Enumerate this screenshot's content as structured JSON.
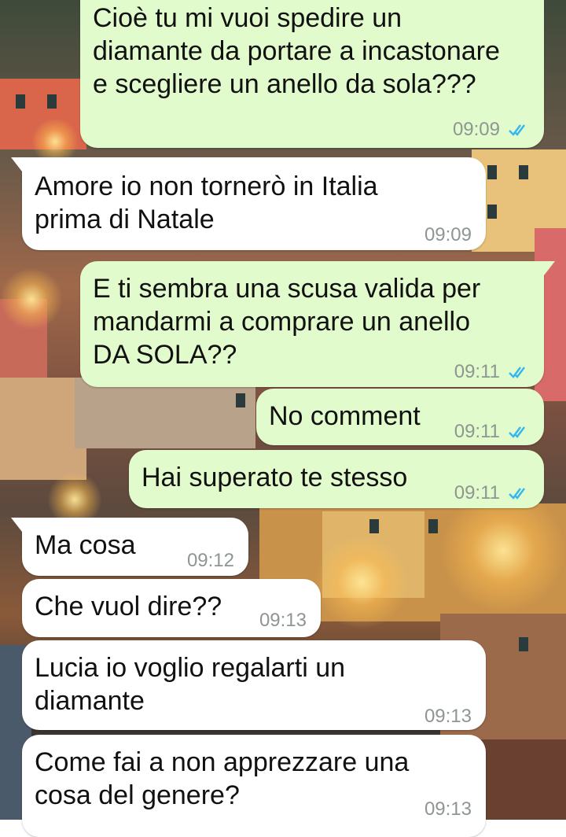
{
  "colors": {
    "outgoing_bubble": "#e2fbcc",
    "incoming_bubble": "#ffffff",
    "read_ticks": "#34b7f1",
    "timestamp": "#8e9691"
  },
  "messages": [
    {
      "direction": "outgoing",
      "text": "Cioè tu mi vuoi spedire un\ndiamante da portare a incastonare\ne scegliere un anello da sola???",
      "time": "09:09",
      "status": "read-ticks-icon"
    },
    {
      "direction": "incoming",
      "text": "Amore io non tornerò in Italia\nprima di Natale",
      "time": "09:09"
    },
    {
      "direction": "outgoing",
      "text": "E ti sembra una scusa valida per\nmandarmi a comprare un anello\nDA SOLA??",
      "time": "09:11",
      "status": "read-ticks-icon"
    },
    {
      "direction": "outgoing",
      "text": "No comment",
      "time": "09:11",
      "status": "read-ticks-icon"
    },
    {
      "direction": "outgoing",
      "text": "Hai superato te stesso",
      "time": "09:11",
      "status": "read-ticks-icon"
    },
    {
      "direction": "incoming",
      "text": "Ma cosa",
      "time": "09:12"
    },
    {
      "direction": "incoming",
      "text": "Che vuol dire??",
      "time": "09:13"
    },
    {
      "direction": "incoming",
      "text": "Lucia io voglio regalarti un\ndiamante",
      "time": "09:13"
    },
    {
      "direction": "incoming",
      "text": "Come fai a non apprezzare una\ncosa del genere?",
      "time": "09:13"
    }
  ]
}
